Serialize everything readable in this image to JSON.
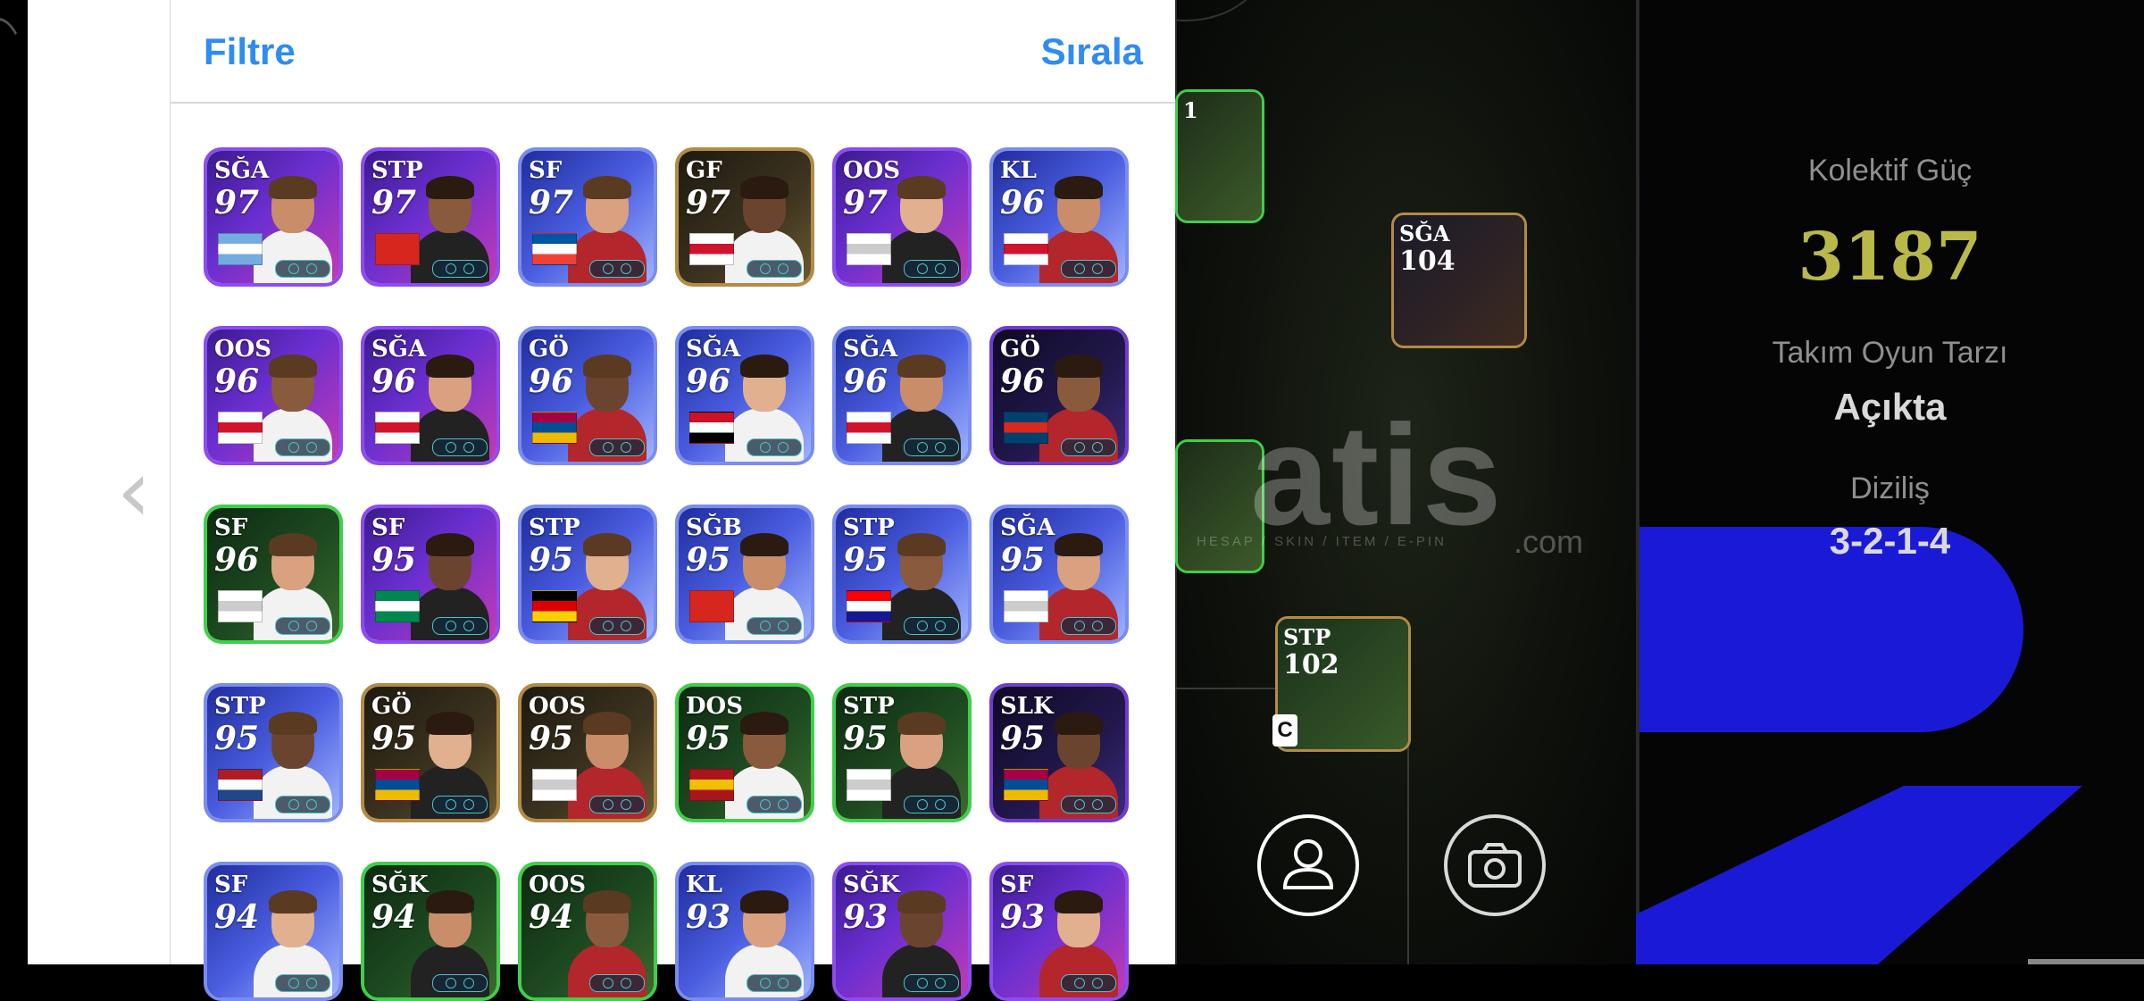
{
  "header": {
    "filter_label": "Filtre",
    "sort_label": "Sırala"
  },
  "cards": [
    {
      "pos": "SĞA",
      "ovr": "97",
      "theme": "purple",
      "badge": "argentina"
    },
    {
      "pos": "STP",
      "ovr": "97",
      "theme": "purple",
      "badge": "arsenal"
    },
    {
      "pos": "SF",
      "ovr": "97",
      "theme": "blue",
      "badge": "france"
    },
    {
      "pos": "GF",
      "ovr": "97",
      "theme": "gold",
      "badge": "england"
    },
    {
      "pos": "OOS",
      "ovr": "97",
      "theme": "purple",
      "badge": "club"
    },
    {
      "pos": "KL",
      "ovr": "96",
      "theme": "blue",
      "badge": "england"
    },
    {
      "pos": "OOS",
      "ovr": "96",
      "theme": "purple",
      "badge": "england"
    },
    {
      "pos": "SĞA",
      "ovr": "96",
      "theme": "purple",
      "badge": "england"
    },
    {
      "pos": "GÖ",
      "ovr": "96",
      "theme": "blue",
      "badge": "barcelona"
    },
    {
      "pos": "SĞA",
      "ovr": "96",
      "theme": "blue",
      "badge": "egypt"
    },
    {
      "pos": "SĞA",
      "ovr": "96",
      "theme": "blue",
      "badge": "england"
    },
    {
      "pos": "GÖ",
      "ovr": "96",
      "theme": "dark",
      "badge": "psg"
    },
    {
      "pos": "SF",
      "ovr": "96",
      "theme": "green",
      "badge": "club"
    },
    {
      "pos": "SF",
      "ovr": "95",
      "theme": "purple",
      "badge": "nigeria"
    },
    {
      "pos": "STP",
      "ovr": "95",
      "theme": "blue",
      "badge": "germany"
    },
    {
      "pos": "SĞB",
      "ovr": "95",
      "theme": "blue",
      "badge": "arsenal"
    },
    {
      "pos": "STP",
      "ovr": "95",
      "theme": "blue",
      "badge": "croatia"
    },
    {
      "pos": "SĞA",
      "ovr": "95",
      "theme": "blue",
      "badge": "club"
    },
    {
      "pos": "STP",
      "ovr": "95",
      "theme": "blue",
      "badge": "netherlands"
    },
    {
      "pos": "GÖ",
      "ovr": "95",
      "theme": "gold",
      "badge": "barcelona"
    },
    {
      "pos": "OOS",
      "ovr": "95",
      "theme": "gold",
      "badge": "club"
    },
    {
      "pos": "DOS",
      "ovr": "95",
      "theme": "green",
      "badge": "spain"
    },
    {
      "pos": "STP",
      "ovr": "95",
      "theme": "green",
      "badge": "club"
    },
    {
      "pos": "SLK",
      "ovr": "95",
      "theme": "dark",
      "badge": "barcelona"
    },
    {
      "pos": "SF",
      "ovr": "94",
      "theme": "blue",
      "badge": ""
    },
    {
      "pos": "SĞK",
      "ovr": "94",
      "theme": "green",
      "badge": ""
    },
    {
      "pos": "OOS",
      "ovr": "94",
      "theme": "green",
      "badge": ""
    },
    {
      "pos": "KL",
      "ovr": "93",
      "theme": "blue",
      "badge": ""
    },
    {
      "pos": "SĞK",
      "ovr": "93",
      "theme": "purple",
      "badge": ""
    },
    {
      "pos": "SF",
      "ovr": "93",
      "theme": "purple",
      "badge": ""
    }
  ],
  "pitch_cards": [
    {
      "pos": "SĞA",
      "ovr": "104"
    },
    {
      "pos": "STP",
      "ovr": "102"
    },
    {
      "pos": "1",
      "ovr": ""
    },
    {
      "pos": "",
      "ovr": ""
    }
  ],
  "captain_label": "C",
  "watermark": {
    "main": "atis",
    "suffix": ".com",
    "sub": "HESAP / SKIN / ITEM / E-PIN"
  },
  "stats": {
    "power_label": "Kolektif Güç",
    "power_value": "3187",
    "style_label": "Takım Oyun Tarzı",
    "style_value": "Açıkta",
    "formation_label": "Diziliş",
    "formation_value": "3-2-1-4"
  },
  "colors": {
    "accent_blue": "#2f8cf2",
    "power_gold": "#b9b94a"
  },
  "icons": {
    "back": "chevron-left-icon",
    "profile": "person-icon",
    "camera": "camera-icon"
  }
}
